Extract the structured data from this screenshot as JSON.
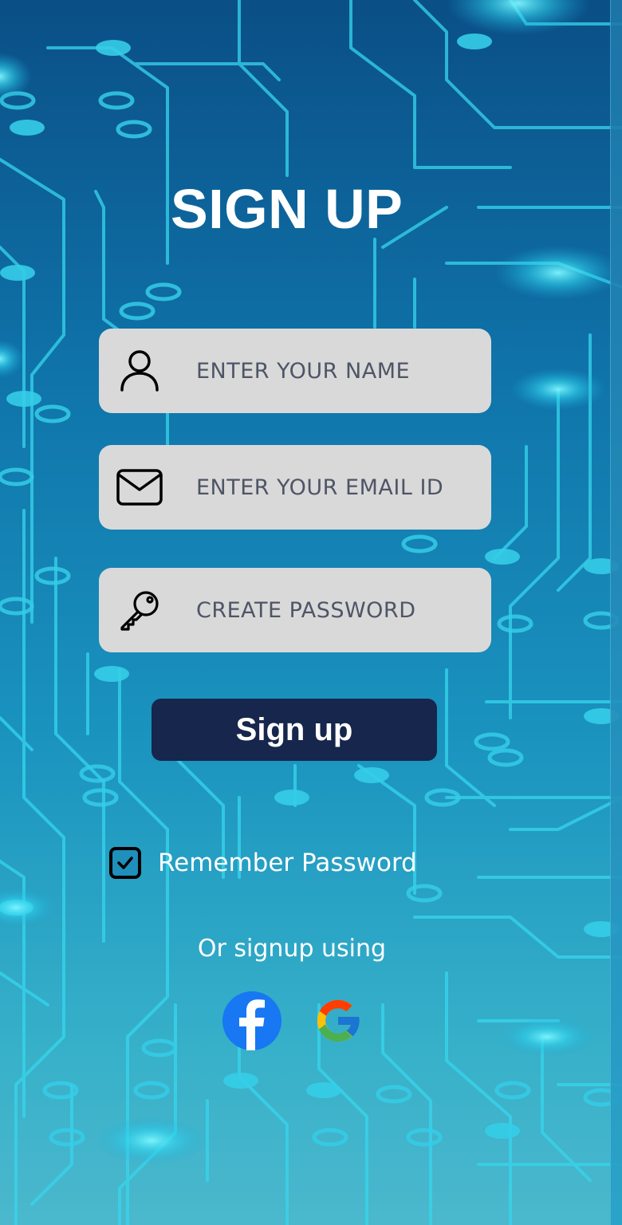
{
  "page": {
    "title": "SIGN UP"
  },
  "form": {
    "name_placeholder": "ENTER YOUR NAME",
    "email_placeholder": "ENTER YOUR EMAIL ID",
    "password_placeholder": "CREATE PASSWORD",
    "name_value": "",
    "email_value": "",
    "password_value": ""
  },
  "actions": {
    "signup_label": "Sign up"
  },
  "remember": {
    "label": "Remember Password",
    "checked": true
  },
  "social": {
    "prompt": "Or signup using",
    "providers": [
      {
        "name": "facebook",
        "icon": "facebook-icon",
        "color": "#1877f2"
      },
      {
        "name": "google",
        "icon": "google-icon",
        "colors": [
          "#ea4335",
          "#fbbc05",
          "#34a853",
          "#4285f4"
        ]
      }
    ]
  },
  "colors": {
    "background_top": "#0a4f86",
    "background_bottom": "#4bb8cd",
    "field_bg": "#d9d9d9",
    "button_bg": "#16264c",
    "circuit": "#37d6ee"
  }
}
